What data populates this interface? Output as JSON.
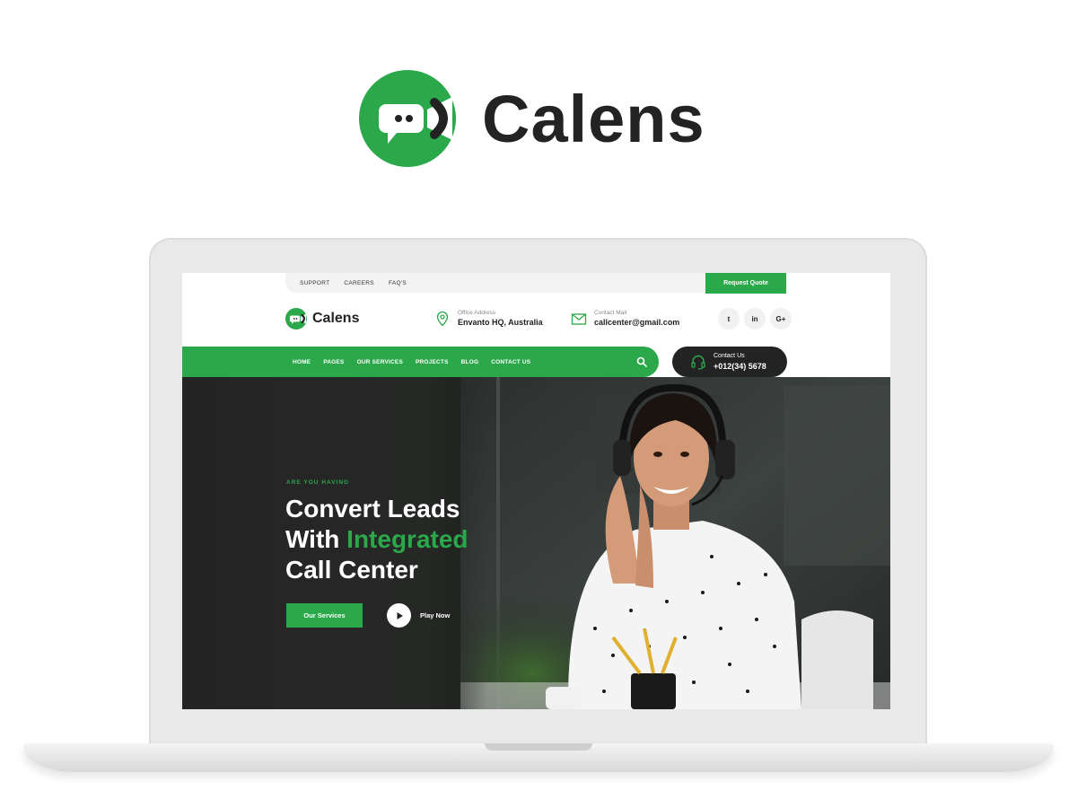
{
  "brand": {
    "name": "Calens",
    "accent_color": "#2aa84a",
    "dark_color": "#232323"
  },
  "topbar": {
    "links": [
      "SUPPORT",
      "CAREERS",
      "FAQ'S"
    ],
    "quote_button": "Request Quote"
  },
  "header": {
    "logo_text": "Calens",
    "office": {
      "label": "Office Address",
      "value": "Envanto HQ, Australia",
      "icon": "map-pin-icon"
    },
    "mail": {
      "label": "Contact Mail",
      "value": "callcenter@gmail.com",
      "icon": "envelope-icon"
    },
    "socials": [
      {
        "name": "twitter-icon",
        "glyph": "t"
      },
      {
        "name": "linkedin-icon",
        "glyph": "in"
      },
      {
        "name": "google-plus-icon",
        "glyph": "G+"
      }
    ]
  },
  "nav": {
    "items": [
      "HOME",
      "PAGES",
      "OUR SERVICES",
      "PROJECTS",
      "BLOG",
      "CONTACT US"
    ],
    "search_icon": "search-icon"
  },
  "contact": {
    "label": "Contact Us",
    "phone": "+012(34) 5678",
    "icon": "headset-icon"
  },
  "hero": {
    "eyebrow": "ARE YOU HAVING",
    "line1": "Convert Leads",
    "line2_prefix": "With ",
    "line2_accent": "Integrated",
    "line3": "Call Center",
    "primary_button": "Our Services",
    "play_label": "Play Now"
  }
}
